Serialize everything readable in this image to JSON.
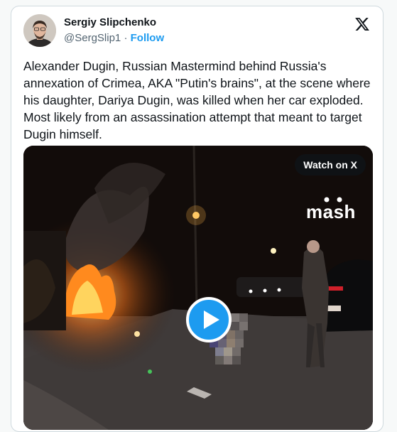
{
  "author": {
    "name": "Sergiy Slipchenko",
    "handle": "@SergSlip1",
    "separator": "·",
    "follow_label": "Follow",
    "avatar_icon": "avatar-photo"
  },
  "header": {
    "x_logo_icon": "x-logo-icon"
  },
  "tweet": {
    "text": "Alexander Dugin, Russian Mastermind behind Russia's annexation of Crimea, AKA \"Putin's brains\", at the scene where his daughter, Dariya Dugin, was killed when her car exploded. Most likely from an assassination attempt that meant to target Dugin himself."
  },
  "media": {
    "watch_label": "Watch on X",
    "watermark": "mash",
    "play_icon": "play-icon"
  },
  "colors": {
    "accent": "#1d9bf0",
    "text": "#0f1419",
    "secondary": "#536471",
    "border": "#cfd9de"
  }
}
